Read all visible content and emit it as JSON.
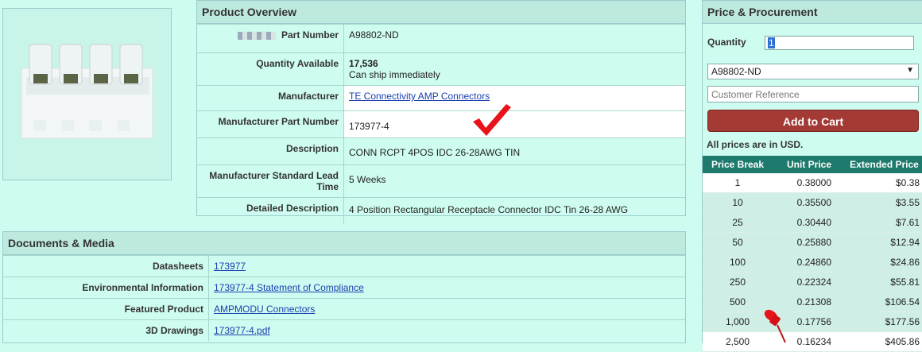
{
  "product_image": {
    "alt": "connector"
  },
  "overview": {
    "title": "Product Overview",
    "rows": [
      {
        "label": "Part Number",
        "value": "A98802-ND"
      },
      {
        "label": "Quantity Available",
        "value": "17,536",
        "note": "Can ship immediately"
      },
      {
        "label": "Manufacturer",
        "value": "TE Connectivity AMP Connectors"
      },
      {
        "label": "Manufacturer Part Number",
        "value": "173977-4"
      },
      {
        "label": "Description",
        "value": "CONN RCPT 4POS IDC 26-28AWG TIN"
      },
      {
        "label": "Manufacturer Standard Lead Time",
        "value": "5 Weeks"
      },
      {
        "label": "Detailed Description",
        "value": "4 Position Rectangular Receptacle Connector IDC Tin 26-28 AWG"
      }
    ]
  },
  "docs": {
    "title": "Documents & Media",
    "rows": [
      {
        "label": "Datasheets",
        "value": "173977"
      },
      {
        "label": "Environmental Information",
        "value": "173977-4 Statement of Compliance"
      },
      {
        "label": "Featured Product",
        "value": "AMPMODU Connectors"
      },
      {
        "label": "3D Drawings",
        "value": "173977-4.pdf"
      }
    ]
  },
  "price": {
    "title": "Price & Procurement",
    "quantity_label": "Quantity",
    "quantity_value": "1",
    "part_select": "A98802-ND",
    "customer_ref_placeholder": "Customer Reference",
    "add_to_cart": "Add to Cart",
    "currency_note": "All prices are in USD.",
    "headers": [
      "Price Break",
      "Unit Price",
      "Extended Price"
    ],
    "rows": [
      [
        "1",
        "0.38000",
        "$0.38"
      ],
      [
        "10",
        "0.35500",
        "$3.55"
      ],
      [
        "25",
        "0.30440",
        "$7.61"
      ],
      [
        "50",
        "0.25880",
        "$12.94"
      ],
      [
        "100",
        "0.24860",
        "$24.86"
      ],
      [
        "250",
        "0.22324",
        "$55.81"
      ],
      [
        "500",
        "0.21308",
        "$106.54"
      ],
      [
        "1,000",
        "0.17756",
        "$177.56"
      ],
      [
        "2,500",
        "0.16234",
        "$405.86"
      ]
    ]
  },
  "colors": {
    "accent": "#1e7a6c",
    "cart": "#a33a35",
    "background": "#cffcf0"
  }
}
